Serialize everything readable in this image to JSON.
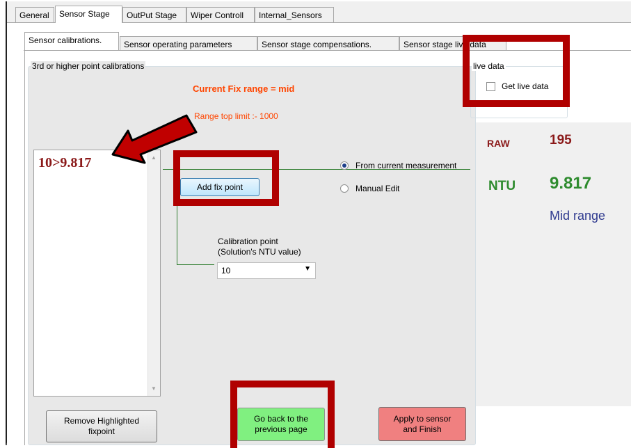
{
  "top_tabs": [
    "General",
    "Sensor Stage",
    "OutPut Stage",
    "Wiper Controll",
    "Internal_Sensors"
  ],
  "sub_tabs": [
    "Sensor calibrations.",
    "Sensor operating parameters",
    "Sensor stage compensations.",
    "Sensor stage live data"
  ],
  "calib_group": {
    "legend": "3rd or higher point calibrations",
    "fix_range": "Current  Fix range = mid",
    "range_top": "Range top limit :-   1000",
    "list_items": [
      "10>9.817"
    ],
    "add_fix_point": "Add fix point",
    "radio_current": "From current measurement",
    "radio_manual": "Manual Edit",
    "calib_label_1": "Calibration point",
    "calib_label_2": "(Solution's NTU value)",
    "calib_value": "10",
    "remove_btn_1": "Remove Highlighted",
    "remove_btn_2": "fixpoint",
    "back_btn_1": "Go back to the",
    "back_btn_2": "previous page",
    "apply_btn_1": "Apply to sensor",
    "apply_btn_2": "and Finish"
  },
  "live_group": {
    "legend": "live data",
    "checkbox_label": "Get live data",
    "checked": false
  },
  "readings": {
    "raw_label": "RAW",
    "raw_value": "195",
    "ntu_label": "NTU",
    "ntu_value": "9.817",
    "range_text": "Mid range"
  },
  "colors": {
    "annotation_red": "#b00000",
    "fix_range_orange": "#ff4500",
    "raw_color": "#8b1a1a",
    "ntu_green": "#2e8b2e",
    "range_blue": "#2f3a8f",
    "back_btn_bg": "#80f080",
    "apply_btn_bg": "#f08080"
  }
}
